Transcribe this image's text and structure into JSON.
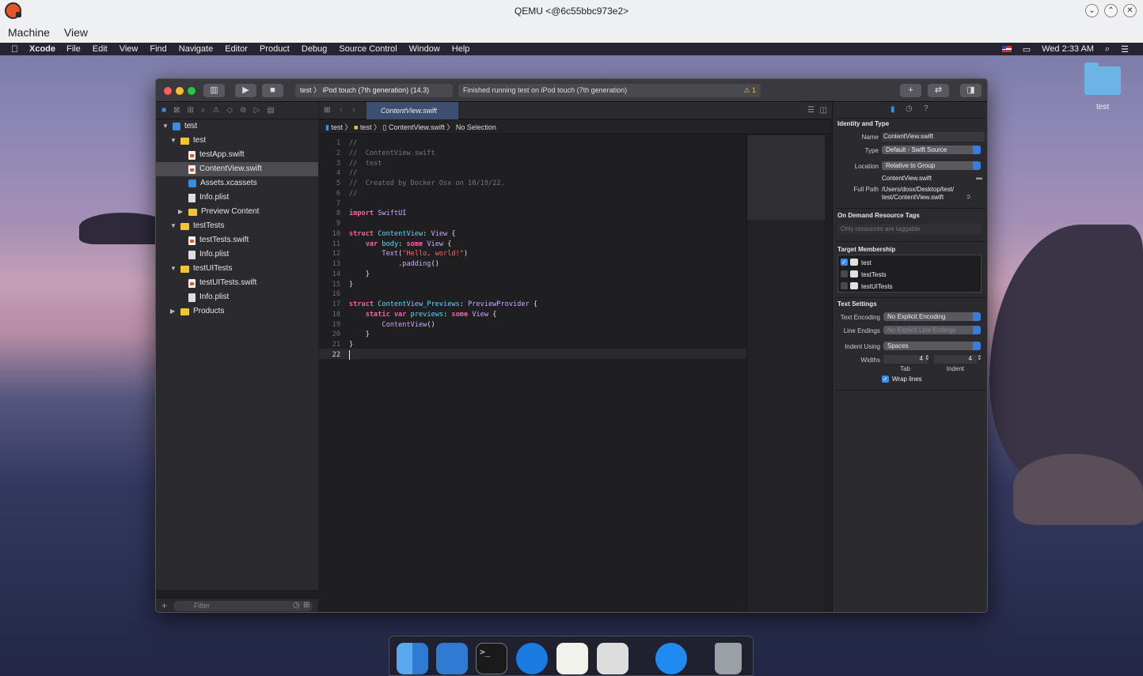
{
  "qemu": {
    "title": "QEMU <@6c55bbc973e2>",
    "menu": [
      "Machine",
      "View"
    ]
  },
  "mac_menu": {
    "app": "Xcode",
    "items": [
      "File",
      "Edit",
      "View",
      "Find",
      "Navigate",
      "Editor",
      "Product",
      "Debug",
      "Source Control",
      "Window",
      "Help"
    ],
    "clock": "Wed 2:33 AM"
  },
  "desktop": {
    "folder_label": "test"
  },
  "toolbar": {
    "scheme": "test",
    "device": "iPod touch (7th generation) (14.3)",
    "activity": "Finished running test on iPod touch (7th generation)",
    "warnings": "1"
  },
  "navigator": {
    "items": [
      {
        "label": "test",
        "kind": "project",
        "level": 0,
        "badge": "?"
      },
      {
        "label": "test",
        "kind": "folder",
        "level": 1
      },
      {
        "label": "testApp.swift",
        "kind": "swift",
        "level": 2
      },
      {
        "label": "ContentView.swift",
        "kind": "swift",
        "level": 2,
        "selected": true
      },
      {
        "label": "Assets.xcassets",
        "kind": "assets",
        "level": 2
      },
      {
        "label": "Info.plist",
        "kind": "plist",
        "level": 2
      },
      {
        "label": "Preview Content",
        "kind": "folder-closed",
        "level": 2
      },
      {
        "label": "testTests",
        "kind": "folder",
        "level": 1
      },
      {
        "label": "testTests.swift",
        "kind": "swift",
        "level": 2
      },
      {
        "label": "Info.plist",
        "kind": "plist",
        "level": 2
      },
      {
        "label": "testUITests",
        "kind": "folder",
        "level": 1
      },
      {
        "label": "testUITests.swift",
        "kind": "swift",
        "level": 2
      },
      {
        "label": "Info.plist",
        "kind": "plist",
        "level": 2
      },
      {
        "label": "Products",
        "kind": "folder-closed",
        "level": 1
      }
    ],
    "filter_placeholder": "Filter"
  },
  "editor": {
    "tab": "ContentView.swift",
    "jumpbar": [
      "test",
      "test",
      "ContentView.swift",
      "No Selection"
    ],
    "lines": [
      "//",
      "//  ContentView.swift",
      "//  test",
      "//",
      "//  Created by Docker Osx on 10/19/22.",
      "//",
      "",
      "import SwiftUI",
      "",
      "struct ContentView: View {",
      "    var body: some View {",
      "        Text(\"Hello, world!\")",
      "            .padding()",
      "    }",
      "}",
      "",
      "struct ContentView_Previews: PreviewProvider {",
      "    static var previews: some View {",
      "        ContentView()",
      "    }",
      "}",
      ""
    ]
  },
  "inspector": {
    "identity_title": "Identity and Type",
    "name_label": "Name",
    "name": "ContentView.swift",
    "type_label": "Type",
    "type": "Default - Swift Source",
    "location_label": "Location",
    "location": "Relative to Group",
    "location_file": "ContentView.swift",
    "fullpath_label": "Full Path",
    "fullpath1": "/Users/dosx/Desktop/test/",
    "fullpath2": "test/ContentView.swift",
    "odr_title": "On Demand Resource Tags",
    "odr_placeholder": "Only resources are taggable",
    "tm_title": "Target Membership",
    "targets": [
      {
        "name": "test",
        "checked": true
      },
      {
        "name": "testTests",
        "checked": false
      },
      {
        "name": "testUITests",
        "checked": false
      }
    ],
    "ts_title": "Text Settings",
    "enc_label": "Text Encoding",
    "enc": "No Explicit Encoding",
    "le_label": "Line Endings",
    "le": "No Explicit Line Endings",
    "indent_label": "Indent Using",
    "indent": "Spaces",
    "widths_label": "Widths",
    "tab_w": "4",
    "indent_w": "4",
    "tab_lbl": "Tab",
    "indent_lbl": "Indent",
    "wrap": "Wrap lines"
  },
  "colors": {
    "keyword": "#fc5fa3",
    "type": "#d0a8ff",
    "string": "#fc6a5d",
    "comment": "#6c7986",
    "decl": "#5dd8ff",
    "accent": "#3a8ee6"
  }
}
